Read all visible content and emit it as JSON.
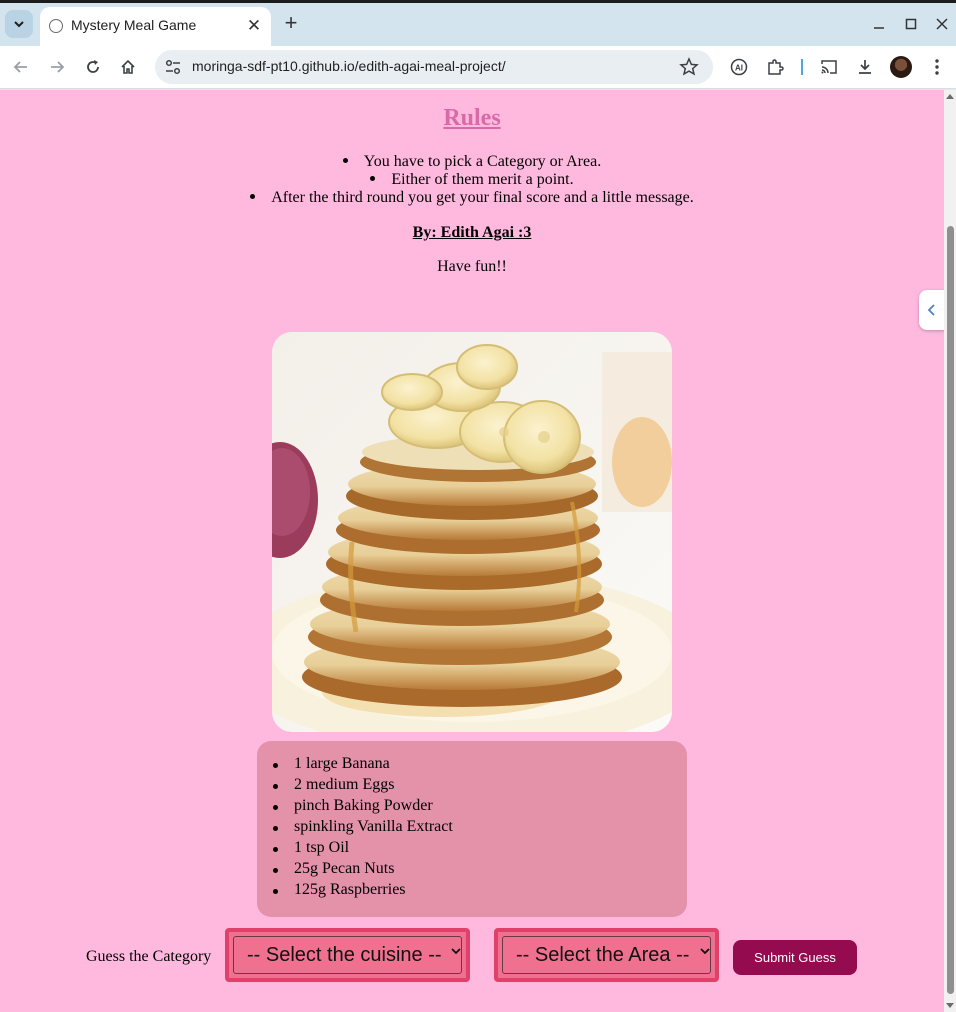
{
  "browser": {
    "tab_title": "Mystery Meal Game",
    "url": "moringa-sdf-pt10.github.io/edith-agai-meal-project/"
  },
  "page": {
    "rules_title": "Rules",
    "rules": [
      "You have to pick a Category or Area.",
      "Either of them merit a point.",
      "After the third round you get your final score and a little message."
    ],
    "author": "By: Edith Agai :3",
    "greeting": "Have fun!!",
    "ingredients": [
      "1 large Banana",
      "2 medium Eggs",
      "pinch Baking Powder",
      "spinkling Vanilla Extract",
      "1 tsp Oil",
      "25g Pecan Nuts",
      "125g Raspberries"
    ],
    "guess_label": "Guess the Category",
    "category_select_value": "-- Select the cuisine --",
    "area_select_value": "-- Select the Area --",
    "submit_label": "Submit Guess"
  },
  "colors": {
    "page_background": "#ffb9df",
    "rules_title": "#d86aa8",
    "ingredients_box": "#e491aa",
    "select_fill": "#f0718f",
    "select_border": "#e0416b",
    "submit_button": "#950b4f"
  },
  "icons": {
    "tab_menu": "chevron-down-icon",
    "tab_favicon": "globe-icon",
    "tab_close": "close-icon",
    "new_tab": "plus-icon",
    "back": "arrow-left-icon",
    "forward": "arrow-right-icon",
    "reload": "reload-icon",
    "home": "home-icon",
    "site_info": "tune-icon",
    "bookmark": "star-icon",
    "translate": "ai-icon",
    "extensions": "puzzle-icon",
    "cast": "cast-icon",
    "downloads": "download-icon",
    "menu": "kebab-menu-icon",
    "side_panel": "chevron-left-icon"
  }
}
